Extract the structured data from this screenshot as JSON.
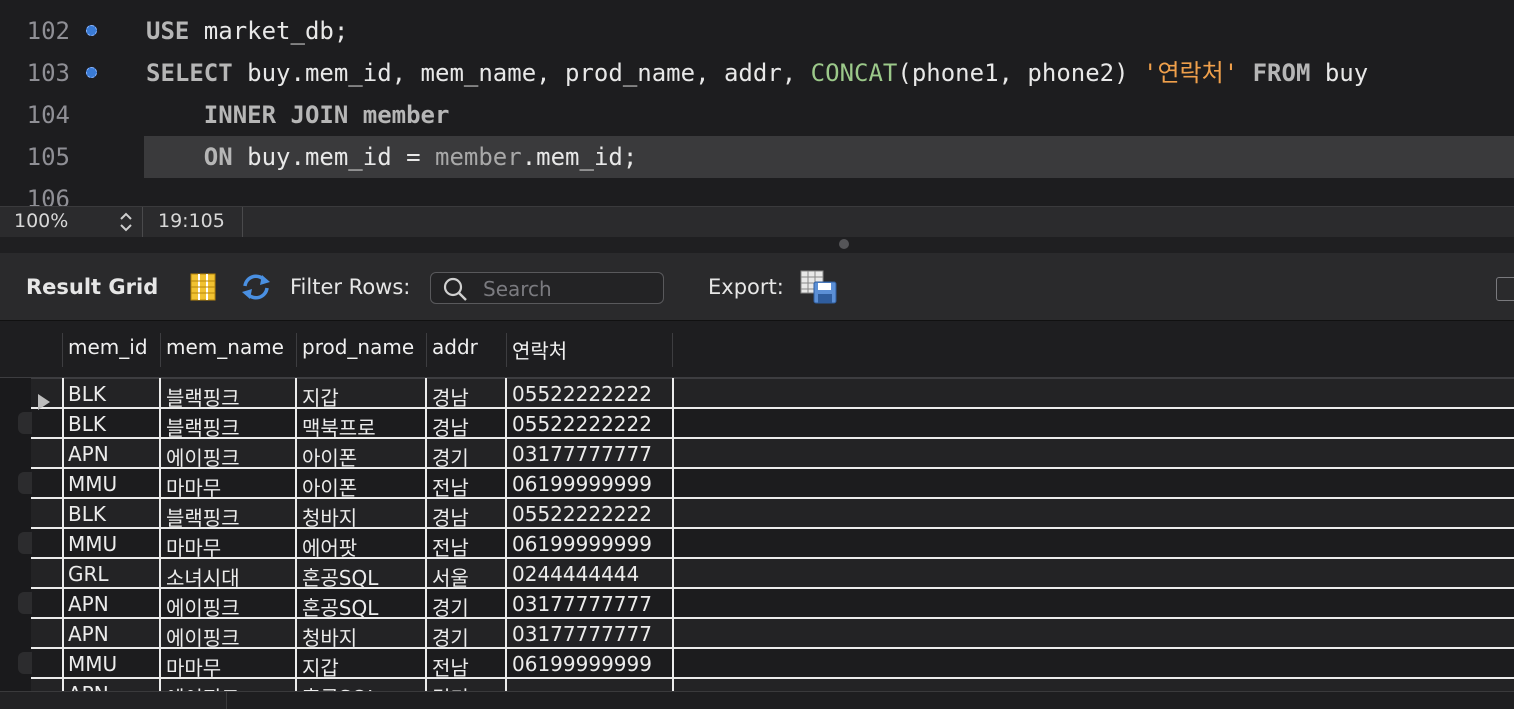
{
  "editor": {
    "lines": [
      {
        "number": "102",
        "tokens": [
          {
            "t": "USE",
            "c": "kw"
          },
          {
            "t": " market_db;",
            "c": ""
          }
        ]
      },
      {
        "number": "103",
        "tokens": [
          {
            "t": "SELECT",
            "c": "kw"
          },
          {
            "t": " buy.mem_id, mem_name, prod_name, addr, ",
            "c": ""
          },
          {
            "t": "CONCAT",
            "c": "fn"
          },
          {
            "t": "(phone1, phone2) ",
            "c": ""
          },
          {
            "t": "'연락처'",
            "c": "str"
          },
          {
            "t": " ",
            "c": ""
          },
          {
            "t": "FROM",
            "c": "kw"
          },
          {
            "t": " buy",
            "c": ""
          }
        ]
      },
      {
        "number": "104",
        "tokens": [
          {
            "t": "    INNER JOIN member",
            "c": "kw"
          }
        ]
      },
      {
        "number": "105",
        "tokens": [
          {
            "t": "    ",
            "c": ""
          },
          {
            "t": "ON",
            "c": "kw"
          },
          {
            "t": " buy.mem_id = ",
            "c": ""
          },
          {
            "t": "member",
            "c": "dim"
          },
          {
            "t": ".mem_id;",
            "c": ""
          }
        ]
      },
      {
        "number": "106",
        "tokens": []
      }
    ]
  },
  "statusbar": {
    "zoom": "100%",
    "cursor": "19:105"
  },
  "toolbar": {
    "title": "Result Grid",
    "filter_label": "Filter Rows:",
    "search_placeholder": "Search",
    "export_label": "Export:"
  },
  "grid": {
    "columns": [
      "mem_id",
      "mem_name",
      "prod_name",
      "addr",
      "연락처"
    ],
    "rows": [
      [
        "BLK",
        "블랙핑크",
        "지갑",
        "경남",
        "05522222222"
      ],
      [
        "BLK",
        "블랙핑크",
        "맥북프로",
        "경남",
        "05522222222"
      ],
      [
        "APN",
        "에이핑크",
        "아이폰",
        "경기",
        "03177777777"
      ],
      [
        "MMU",
        "마마무",
        "아이폰",
        "전남",
        "06199999999"
      ],
      [
        "BLK",
        "블랙핑크",
        "청바지",
        "경남",
        "05522222222"
      ],
      [
        "MMU",
        "마마무",
        "에어팟",
        "전남",
        "06199999999"
      ],
      [
        "GRL",
        "소녀시대",
        "혼공SQL",
        "서울",
        "0244444444"
      ],
      [
        "APN",
        "에이핑크",
        "혼공SQL",
        "경기",
        "03177777777"
      ],
      [
        "APN",
        "에이핑크",
        "청바지",
        "경기",
        "03177777777"
      ],
      [
        "MMU",
        "마마무",
        "지갑",
        "전남",
        "06199999999"
      ],
      [
        "APN",
        "에이핑크",
        "혼공SQL",
        "경기",
        ""
      ]
    ]
  }
}
